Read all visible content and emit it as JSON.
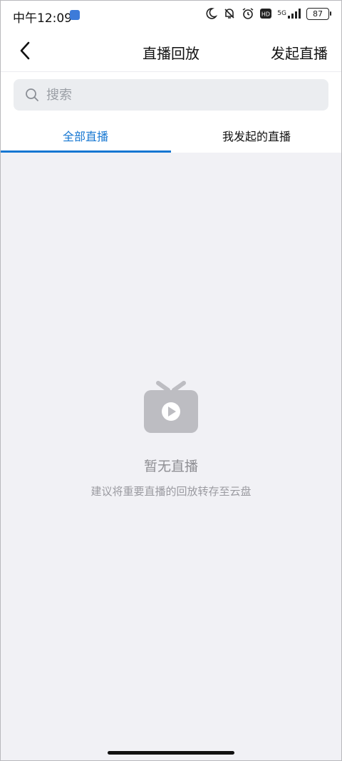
{
  "status_bar": {
    "time": "中午12:09",
    "network": "5G",
    "battery": "87"
  },
  "header": {
    "title": "直播回放",
    "action_label": "发起直播"
  },
  "search": {
    "placeholder": "搜索"
  },
  "tabs": [
    {
      "label": "全部直播",
      "active": true
    },
    {
      "label": "我发起的直播",
      "active": false
    }
  ],
  "empty_state": {
    "icon": "tv-icon",
    "title": "暂无直播",
    "description": "建议将重要直播的回放转存至云盘"
  },
  "colors": {
    "accent": "#1677d2",
    "background": "#f1f1f5",
    "icon_gray": "#bdbdc2"
  }
}
